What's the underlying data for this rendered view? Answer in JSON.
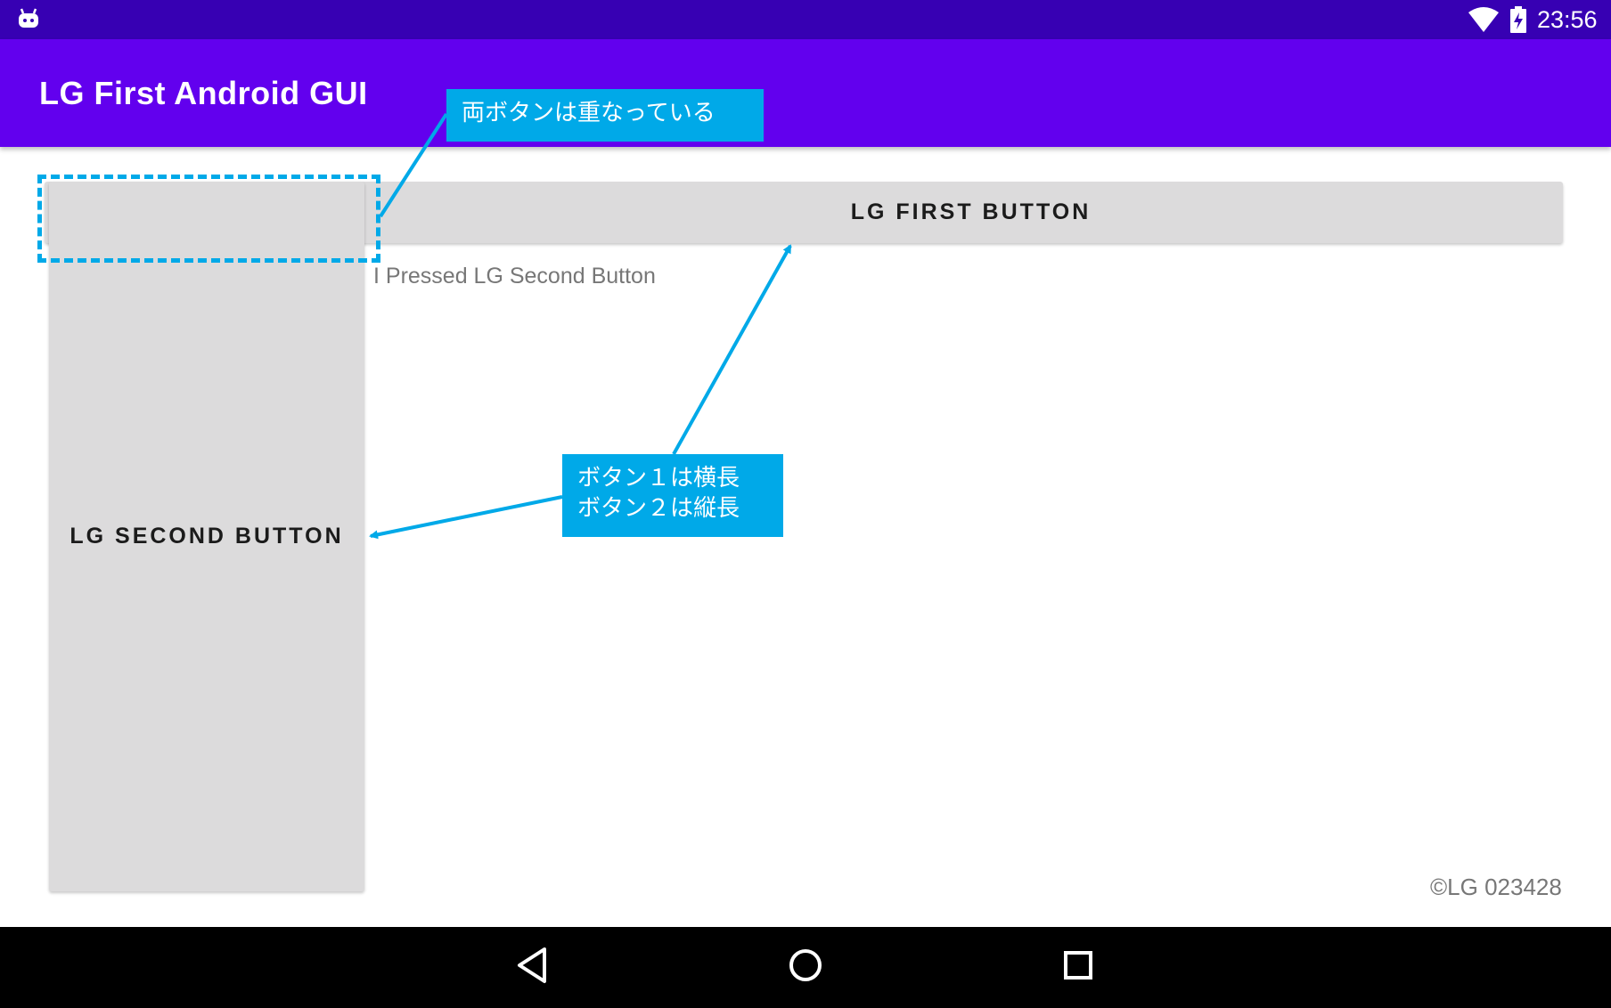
{
  "status_bar": {
    "time": "23:56",
    "icons": [
      "android-robot-icon",
      "wifi-icon",
      "battery-charging-icon"
    ]
  },
  "app_bar": {
    "title": "LG First Android GUI"
  },
  "buttons": {
    "first_label": "LG FIRST BUTTON",
    "second_label": "LG SECOND BUTTON"
  },
  "content": {
    "pressed_text": "I Pressed LG Second Button",
    "copyright": "©LG 023428"
  },
  "annotations": {
    "overlap_note": "両ボタンは重なっている",
    "shape_note": "ボタン１は横長\nボタン２は縦長",
    "color": "#00a9e8"
  },
  "nav_bar": {
    "icons": [
      "back-icon",
      "home-icon",
      "recents-icon"
    ]
  },
  "colors": {
    "status_bar": "#3700b3",
    "app_bar": "#6200ee",
    "button_bg": "#dcdbdc",
    "nav_bar": "#000000"
  }
}
